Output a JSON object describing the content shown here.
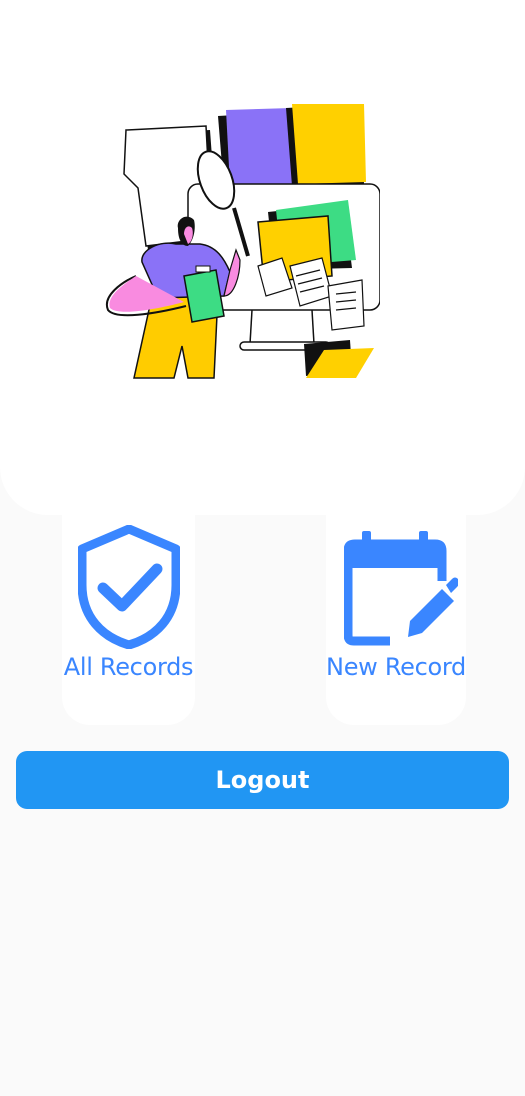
{
  "hero": {
    "illustration_name": "records-search-illustration"
  },
  "actions": {
    "all_records": {
      "label": "All Records",
      "icon": "shield-check-icon"
    },
    "new_record": {
      "label": "New Record",
      "icon": "calendar-edit-icon"
    }
  },
  "logout": {
    "label": "Logout"
  },
  "colors": {
    "accent": "#3a86ff",
    "button": "#2196f3",
    "background": "#fafafa",
    "card": "#ffffff"
  }
}
